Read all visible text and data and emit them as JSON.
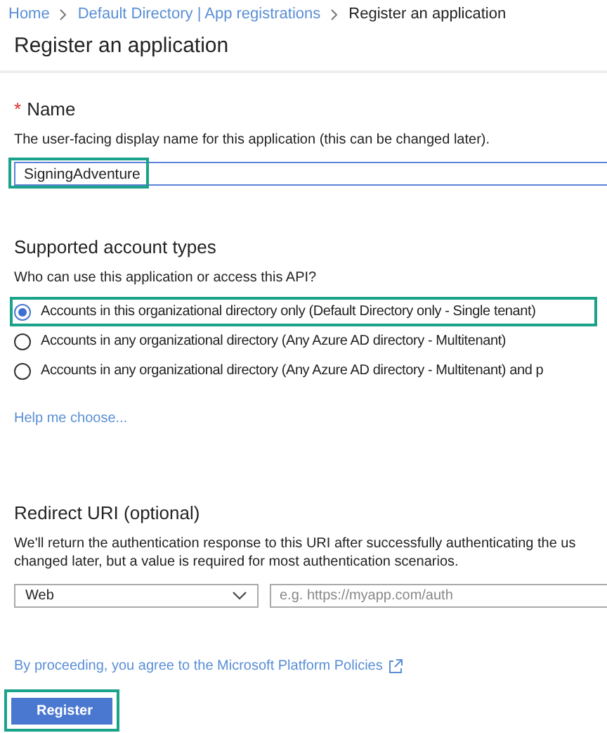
{
  "breadcrumb": [
    {
      "label": "Home",
      "kind": "link"
    },
    {
      "label": "Default Directory | App registrations",
      "kind": "link"
    },
    {
      "label": "Register an application",
      "kind": "current"
    }
  ],
  "title": "Register an application",
  "name_section": {
    "required_mark": "*",
    "label": "Name",
    "description": "The user-facing display name for this application (this can be changed later).",
    "value": "SigningAdventure",
    "highlighted": true
  },
  "account_types": {
    "heading": "Supported account types",
    "question": "Who can use this application or access this API?",
    "options": [
      {
        "label": "Accounts in this organizational directory only (Default Directory only - Single tenant)",
        "selected": true,
        "highlighted": true
      },
      {
        "label": "Accounts in any organizational directory (Any Azure AD directory - Multitenant)",
        "selected": false,
        "highlighted": false
      },
      {
        "label": "Accounts in any organizational directory (Any Azure AD directory - Multitenant) and p",
        "selected": false,
        "highlighted": false
      }
    ],
    "help_link": "Help me choose..."
  },
  "redirect": {
    "heading": "Redirect URI (optional)",
    "description": "We'll return the authentication response to this URI after successfully authenticating the us changed later, but a value is required for most authentication scenarios.",
    "platform": "Web",
    "placeholder": "e.g. https://myapp.com/auth"
  },
  "policy_link": "By proceeding, you agree to the Microsoft Platform Policies",
  "register_button": {
    "label": "Register",
    "highlighted": true
  }
}
